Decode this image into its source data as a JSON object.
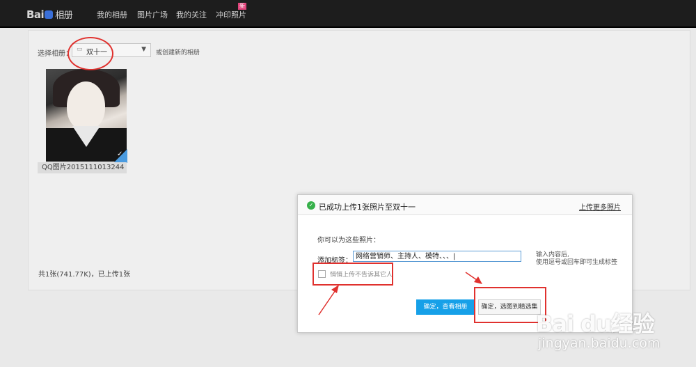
{
  "topbar": {
    "logo": "Bai",
    "logo_product": "相册",
    "nav": [
      "我的相册",
      "图片广场",
      "我的关注",
      "冲印照片"
    ],
    "nav_badge": "新"
  },
  "album_select": {
    "label": "选择相册：",
    "value": "双十一",
    "create_link": "或创建新的相册"
  },
  "photo": {
    "name": "QQ图片2015111013244"
  },
  "upload_status": "共1张(741.77K)，已上传1张",
  "dialog": {
    "title": "已成功上传1张照片至双十一",
    "more_link": "上传更多照片",
    "hint": "你可以为这些照片：",
    "tag_label": "添加标签：",
    "tag_value": "网络营销师、主持人、模特、、、|",
    "tag_tip_line1": "输入内容后,",
    "tag_tip_line2": "使用逗号或回车即可生成标签",
    "silent_label": "悄悄上传不告诉其它人",
    "btn_view": "确定，查看相册",
    "btn_select": "确定，选图到精选集"
  },
  "watermark": {
    "brand": "Bai du经验",
    "url": "jingyan.baidu.com"
  },
  "colors": {
    "accent": "#16a0e8",
    "annotation": "#e0312e",
    "success": "#36b04a",
    "badge": "#e0427a"
  }
}
